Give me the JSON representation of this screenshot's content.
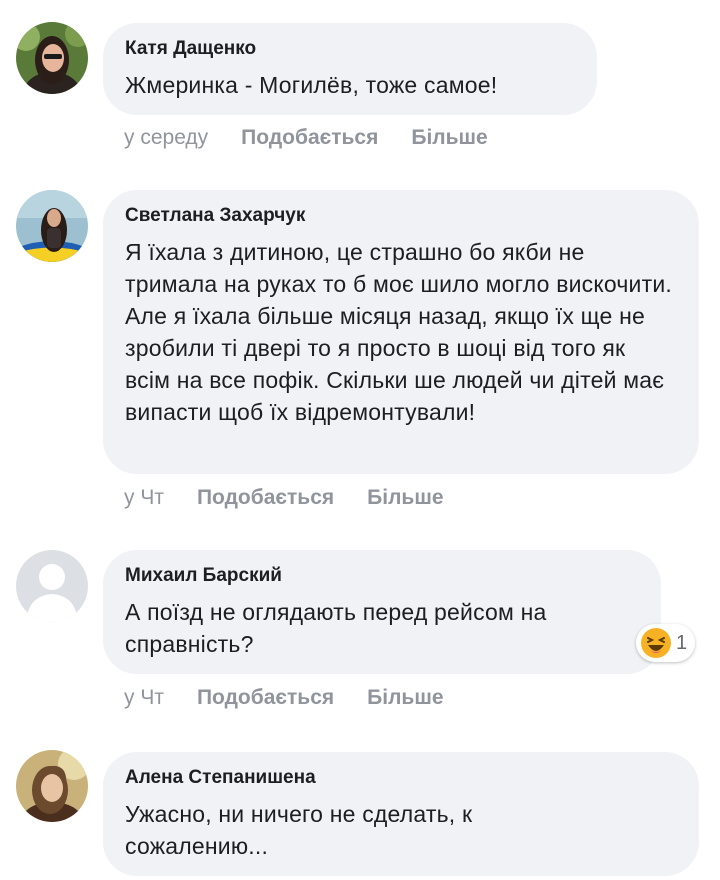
{
  "comments": [
    {
      "author": "Катя Дащенко",
      "text": "Жмеринка - Могилёв, тоже самое!",
      "time": "у середу",
      "like_label": "Подобається",
      "more_label": "Більше"
    },
    {
      "author": "Светлана Захарчук",
      "text": "Я їхала з дитиною, це страшно бо якби не тримала на руках то б моє шило могло вискочити. Але я їхала більше місяця назад, якщо їх ще не зробили ті двері то я просто в шоці від того як всім на все пофік. Скільки ше людей чи дітей має випасти щоб їх відремонтували!",
      "time": "у Чт",
      "like_label": "Подобається",
      "more_label": "Більше"
    },
    {
      "author": "Михаил Барский",
      "text": "А поїзд не оглядають перед рейсом на справність?",
      "time": "у Чт",
      "like_label": "Подобається",
      "more_label": "Більше",
      "reaction": {
        "icon": "haha-emoji-icon",
        "count": "1"
      }
    },
    {
      "author": "Алена Степанишена",
      "text": "Ужасно, ни ничего не сделать, к сожалению...",
      "time": "",
      "like_label": "",
      "more_label": ""
    }
  ],
  "colors": {
    "bubble": "#f0f2f5",
    "meta": "#90949c",
    "reaction_face": "#f7b125"
  }
}
